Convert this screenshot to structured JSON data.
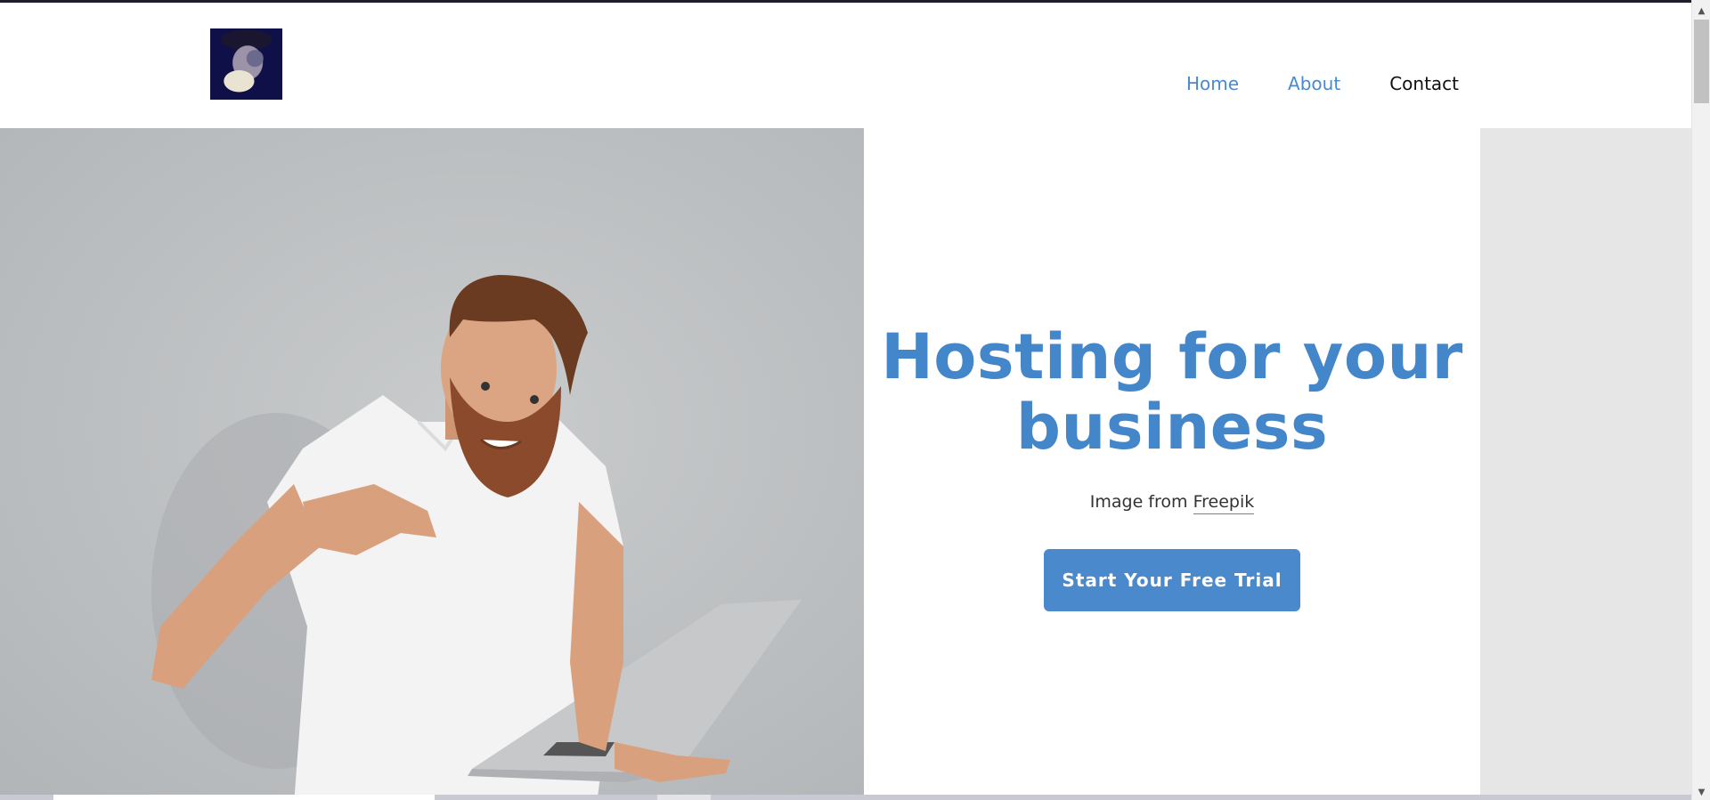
{
  "header": {
    "nav": [
      {
        "label": "Home"
      },
      {
        "label": "About"
      },
      {
        "label": "Contact"
      }
    ]
  },
  "hero": {
    "title": "Hosting for your business",
    "credit_prefix": "Image from ",
    "credit_link": "Freepik",
    "cta_label": "Start Your Free Trial"
  },
  "scrollbar": {
    "up_icon": "▲",
    "down_icon": "▼"
  },
  "colors": {
    "accent": "#4a89cc",
    "title": "#4386c9",
    "side_panel": "#e6e6e6"
  }
}
